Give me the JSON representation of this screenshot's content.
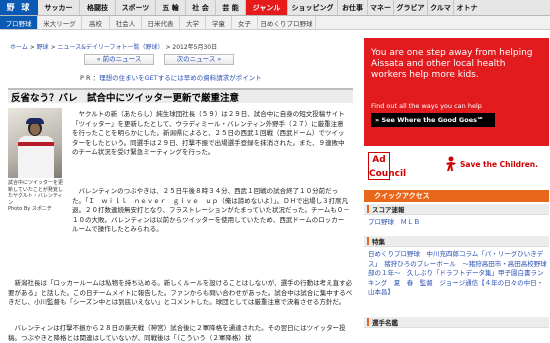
{
  "topnav": {
    "logo": "野 球",
    "items": [
      "サッカー",
      "格闘技",
      "スポーツ",
      "五 輪",
      "社 会",
      "芸 能",
      "ジャンル",
      "ショッピング",
      "お仕事",
      "マネー",
      "グラビア",
      "クルマ",
      "オトナ"
    ]
  },
  "subnav": {
    "items": [
      "プロ野球",
      "米大リーグ",
      "高校",
      "社会人",
      "日米代表",
      "大学",
      "学童",
      "女子",
      "日めくりプロ野球"
    ]
  },
  "breadcrumb": {
    "home": "ホーム",
    "sep1": " > ",
    "baseball": "野球",
    "sep2": " > ",
    "news": "ニュース&デイリーフォト一覧（野球）",
    "sep3": " > ",
    "date": "2012年5月30日"
  },
  "pager": {
    "prev": "« 前のニュース",
    "next": "次のニュース »"
  },
  "pr": {
    "label": "P R ：",
    "link": "理想の住まいをGETするには早めの資料請求がポイント"
  },
  "article": {
    "headline": "反省なう？バレ　試合中にツイッター更新で厳重注意",
    "caption": "試合中にツイッターを更新していたことが発覚したヤクルト・バレンティン\nPhoto By スポニチ",
    "p1": "　ヤクルトの新（あたらし）純生球団社長（５９）は２９日、試合中に自身の短文投稿サイト「ツイッター」を更新したとして、ウラディミール・バレンティン外野手（２７）に厳重注意を行ったことを明らかにした。新潟県によると、２５日の西武１回戦（西武ドーム）でツイッターをしたという。同選手は２９日、打撃不振で出場選手登録を抹消された。また、９連敗中のチーム状況を受け緊急ミーティングを行った。",
    "p2": "　バレンティンのつぶやきは、２５日午後８時３４分、西武１回戦の試合終了１０分前だった。「Ｉ　ｗｉｌｌ　ｎｅｖｅｒ　ｇｉｖｅ　ｕｐ（俺は諦めないよ）」。ＤＨで出場し３打席凡退。２０打数連続無安打となり、フラストレーションがたまっていた状況だった。チームも０－１０の大敗。バレンティンは以前からツイッターを使用していたため、西武ドームのロッカールームで操作したとみられる。",
    "p3": "　新潟社長は「ロッカールームは私物を持ち込める。新しくルールを設けることはしないが、選手の行動は考え直す必要がある」と話した。この日チームメイトに報告した。ファンからも問い合わせがあった。試合中は試合に集中するべきだし、小川監督も「シーズン中とは到底いえない」とコメントした。球団としては厳重注意で決着させる方針だ。",
    "p4": "　バレンティンは打撃不振から２８日の楽天戦（神宮）試合後に２軍降格を通達された。その翌日にはツイッター投稿。つぶやきと降格とは関連はしていないが、同戦後は「（こういう（２軍降格）状"
  },
  "ad": {
    "headline": "You are one step away from helping Aissata and other local health workers help more kids.",
    "sub": "Find out all the ways you can help",
    "cta": "» See Where the Good Goes℠",
    "adcouncil": "Ad Council",
    "stc": "Save the Children."
  },
  "sidebar": {
    "quick_access": "クイックアクセス",
    "score_head": "スコア速報",
    "score_links": "プロ野球　ＭＬＢ",
    "keyword_head": "特集",
    "keyword_links": "日めくりプロ野球　中川充四郎コラム「パ・リーグひいきデス」　猪狩ひろのプレーボール　～猪狩高田市・高田高校野球部の１年～　久しぶり「ドラフトデータ集」甲子園白書ランキング　夏　春　監督　ジョージ通信【４年の日々の中日・山本昌】",
    "col_head": "選手名鑑"
  }
}
